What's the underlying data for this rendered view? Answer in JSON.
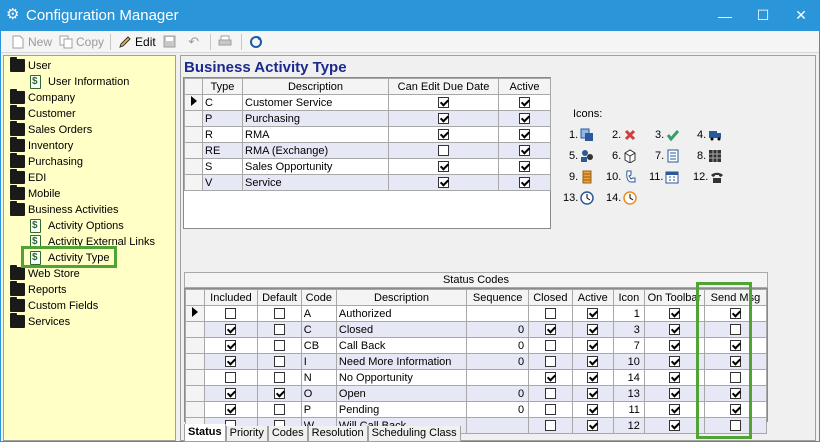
{
  "window": {
    "title": "Configuration Manager",
    "min": "—",
    "max": "☐",
    "close": "✕"
  },
  "toolbar": {
    "new_label": "New",
    "copy_label": "Copy",
    "edit_label": "Edit"
  },
  "sidebar": {
    "items": [
      {
        "label": "User",
        "type": "folder",
        "indent": 0
      },
      {
        "label": "User Information",
        "type": "doc",
        "indent": 1
      },
      {
        "label": "Company",
        "type": "folder",
        "indent": 0
      },
      {
        "label": "Customer",
        "type": "folder",
        "indent": 0
      },
      {
        "label": "Sales Orders",
        "type": "folder",
        "indent": 0
      },
      {
        "label": "Inventory",
        "type": "folder",
        "indent": 0
      },
      {
        "label": "Purchasing",
        "type": "folder",
        "indent": 0
      },
      {
        "label": "EDI",
        "type": "folder",
        "indent": 0
      },
      {
        "label": "Mobile",
        "type": "folder",
        "indent": 0
      },
      {
        "label": "Business Activities",
        "type": "folder",
        "indent": 0
      },
      {
        "label": "Activity Options",
        "type": "doc",
        "indent": 1
      },
      {
        "label": "Activity External Links",
        "type": "doc",
        "indent": 1
      },
      {
        "label": "Activity Type",
        "type": "doc",
        "indent": 1
      },
      {
        "label": "Web Store",
        "type": "folder",
        "indent": 0
      },
      {
        "label": "Reports",
        "type": "folder",
        "indent": 0
      },
      {
        "label": "Custom Fields",
        "type": "folder",
        "indent": 0
      },
      {
        "label": "Services",
        "type": "folder",
        "indent": 0
      }
    ],
    "selected": "Activity Type"
  },
  "main": {
    "title": "Business Activity Type",
    "type_grid": {
      "headers": [
        "Type",
        "Description",
        "Can Edit Due Date",
        "Active"
      ],
      "rows": [
        {
          "type": "C",
          "description": "Customer Service",
          "can_edit": true,
          "active": true
        },
        {
          "type": "P",
          "description": "Purchasing",
          "can_edit": true,
          "active": true
        },
        {
          "type": "R",
          "description": "RMA",
          "can_edit": true,
          "active": true
        },
        {
          "type": "RE",
          "description": "RMA (Exchange)",
          "can_edit": false,
          "active": true
        },
        {
          "type": "S",
          "description": "Sales Opportunity",
          "can_edit": true,
          "active": true
        },
        {
          "type": "V",
          "description": "Service",
          "can_edit": true,
          "active": true
        }
      ]
    },
    "icons_legend": {
      "label": "Icons:",
      "items": [
        {
          "num": "1.",
          "icon": "document-stack-icon"
        },
        {
          "num": "2.",
          "icon": "red-x-icon"
        },
        {
          "num": "3.",
          "icon": "checkmark-icon"
        },
        {
          "num": "4.",
          "icon": "truck-icon"
        },
        {
          "num": "5.",
          "icon": "people-icon"
        },
        {
          "num": "6.",
          "icon": "box-icon"
        },
        {
          "num": "7.",
          "icon": "ledger-icon"
        },
        {
          "num": "8.",
          "icon": "grid-icon"
        },
        {
          "num": "9.",
          "icon": "stack-icon"
        },
        {
          "num": "10.",
          "icon": "phone-handset-icon"
        },
        {
          "num": "11.",
          "icon": "calendar-icon"
        },
        {
          "num": "12.",
          "icon": "telephone-icon"
        },
        {
          "num": "13.",
          "icon": "clock-blue-icon"
        },
        {
          "num": "14.",
          "icon": "clock-orange-icon"
        }
      ]
    },
    "status_codes": {
      "title": "Status Codes",
      "headers": [
        "Included",
        "Default",
        "Code",
        "Description",
        "Sequence",
        "Closed",
        "Active",
        "Icon",
        "On Toolbar",
        "Send Msg"
      ],
      "rows": [
        {
          "included": false,
          "default": false,
          "code": "A",
          "description": "Authorized",
          "sequence": "",
          "closed": false,
          "active": true,
          "icon": "1",
          "on_toolbar": true,
          "send_msg": true
        },
        {
          "included": true,
          "default": false,
          "code": "C",
          "description": "Closed",
          "sequence": "0",
          "closed": true,
          "active": true,
          "icon": "3",
          "on_toolbar": true,
          "send_msg": false
        },
        {
          "included": true,
          "default": false,
          "code": "CB",
          "description": "Call Back",
          "sequence": "0",
          "closed": false,
          "active": true,
          "icon": "7",
          "on_toolbar": true,
          "send_msg": true
        },
        {
          "included": true,
          "default": false,
          "code": "I",
          "description": "Need More Information",
          "sequence": "0",
          "closed": false,
          "active": true,
          "icon": "10",
          "on_toolbar": true,
          "send_msg": true
        },
        {
          "included": false,
          "default": false,
          "code": "N",
          "description": "No Opportunity",
          "sequence": "",
          "closed": true,
          "active": true,
          "icon": "14",
          "on_toolbar": true,
          "send_msg": false
        },
        {
          "included": true,
          "default": true,
          "code": "O",
          "description": "Open",
          "sequence": "0",
          "closed": false,
          "active": true,
          "icon": "13",
          "on_toolbar": true,
          "send_msg": true
        },
        {
          "included": true,
          "default": false,
          "code": "P",
          "description": "Pending",
          "sequence": "0",
          "closed": false,
          "active": true,
          "icon": "11",
          "on_toolbar": true,
          "send_msg": true
        },
        {
          "included": false,
          "default": false,
          "code": "W",
          "description": "Will Call Back",
          "sequence": "",
          "closed": false,
          "active": true,
          "icon": "12",
          "on_toolbar": true,
          "send_msg": false
        }
      ]
    },
    "tabs": [
      "Status",
      "Priority",
      "Codes",
      "Resolution",
      "Scheduling Class"
    ],
    "active_tab": "Status"
  },
  "colors": {
    "titlebar": "#2b95d9",
    "sidebar_bg": "#ffffc6",
    "heading": "#1b2b8c",
    "highlight": "#52a335",
    "alt_row": "#e6e8f6"
  }
}
